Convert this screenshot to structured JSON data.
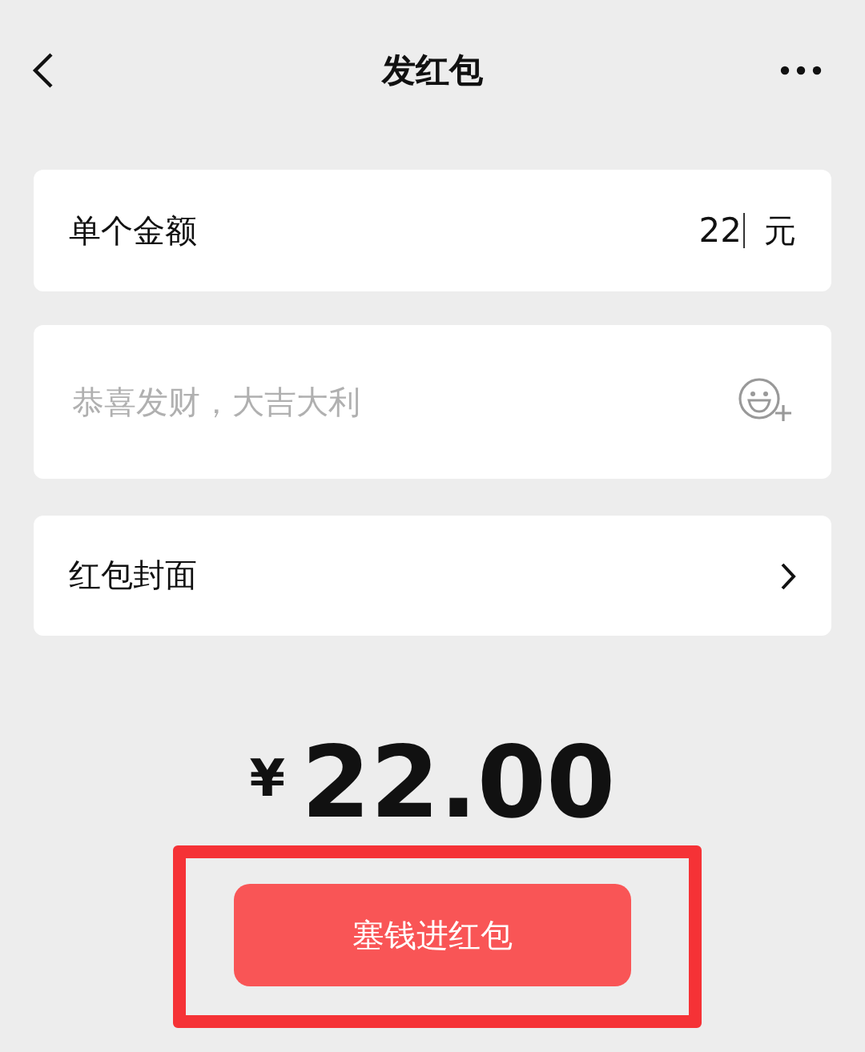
{
  "header": {
    "title": "发红包"
  },
  "amount_field": {
    "label": "单个金额",
    "value": "22",
    "unit": "元"
  },
  "message_field": {
    "placeholder": "恭喜发财，大吉大利"
  },
  "cover_row": {
    "label": "红包封面"
  },
  "total": {
    "currency": "¥",
    "amount": "22.00"
  },
  "submit_button": {
    "label": "塞钱进红包",
    "highlighted": true
  }
}
